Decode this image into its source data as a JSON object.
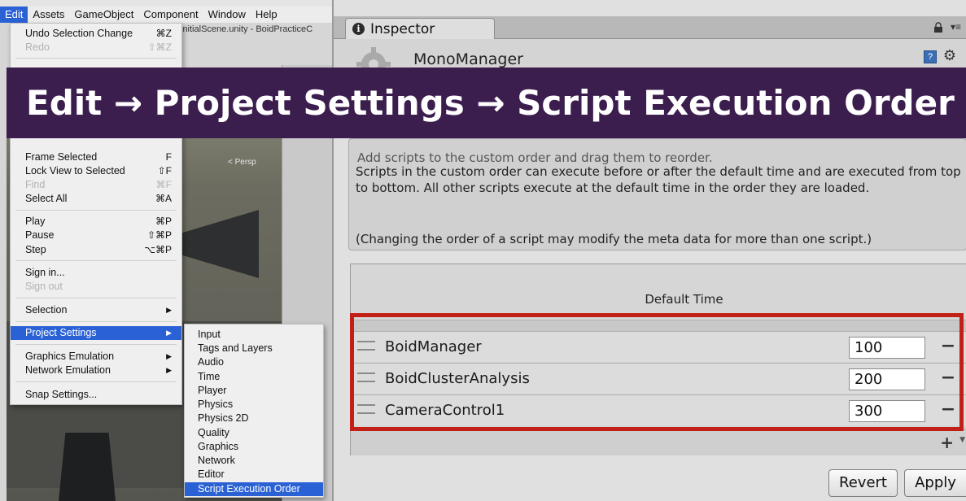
{
  "menubar": {
    "items": [
      "Edit",
      "Assets",
      "GameObject",
      "Component",
      "Window",
      "Help"
    ]
  },
  "editor": {
    "title_fragment": "initialScene.unity - BoidPracticeC",
    "scene_label": "< Persp"
  },
  "edit_menu": {
    "items": [
      {
        "label": "Undo Selection Change",
        "shortcut": "⌘Z"
      },
      {
        "label": "Redo",
        "shortcut": "⇧⌘Z"
      },
      {
        "label": "Frame Selected",
        "shortcut": "F"
      },
      {
        "label": "Lock View to Selected",
        "shortcut": "⇧F"
      },
      {
        "label": "Find",
        "shortcut": "⌘F"
      },
      {
        "label": "Select All",
        "shortcut": "⌘A"
      },
      {
        "label": "Play",
        "shortcut": "⌘P"
      },
      {
        "label": "Pause",
        "shortcut": "⇧⌘P"
      },
      {
        "label": "Step",
        "shortcut": "⌥⌘P"
      },
      {
        "label": "Sign in..."
      },
      {
        "label": "Sign out"
      },
      {
        "label": "Selection"
      },
      {
        "label": "Project Settings"
      },
      {
        "label": "Graphics Emulation"
      },
      {
        "label": "Network Emulation"
      },
      {
        "label": "Snap Settings..."
      }
    ]
  },
  "submenu": {
    "items": [
      "Input",
      "Tags and Layers",
      "Audio",
      "Time",
      "Player",
      "Physics",
      "Physics 2D",
      "Quality",
      "Graphics",
      "Network",
      "Editor",
      "Script Execution Order"
    ]
  },
  "inspector": {
    "tab_label": "Inspector",
    "component_name": "MonoManager",
    "desc_hidden": "Add scripts to the custom order and drag them to reorder.",
    "desc_p1": "Scripts in the custom order can execute before or after the default time and are executed from top to bottom. All other scripts execute at the default time in the order they are loaded.",
    "desc_p2": "(Changing the order of a script may modify the meta data for more than one script.)",
    "default_time_label": "Default Time",
    "scripts": [
      {
        "name": "BoidManager",
        "order": "100"
      },
      {
        "name": "BoidClusterAnalysis",
        "order": "200"
      },
      {
        "name": "CameraControl1",
        "order": "300"
      }
    ],
    "remove_label": "−",
    "add_label": "+",
    "revert_label": "Revert",
    "apply_label": "Apply"
  },
  "banner": {
    "text": "Edit → Project Settings → Script Execution Order"
  },
  "colors": {
    "menu_highlight": "#2a62d6",
    "banner_bg": "#3c1e4e",
    "frame_red": "#c22016"
  }
}
